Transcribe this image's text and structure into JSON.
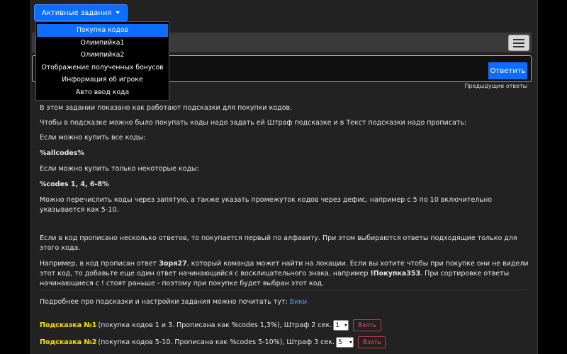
{
  "header": {
    "tasks_button_label": "Активные задания",
    "menu_items": [
      {
        "label": "Покупка кодов",
        "active": true
      },
      {
        "label": "Олимпийка1"
      },
      {
        "label": "Олимпийка2"
      },
      {
        "label": "Отображение полученных бонусов"
      },
      {
        "label": "Информация об игроке"
      },
      {
        "label": "Авто ввод кода"
      }
    ]
  },
  "answer": {
    "value": "",
    "submit_label": "Ответить",
    "previous_answers_link": "Предыдущие ответы"
  },
  "content": {
    "p1": "В этом задании показано как работают подсказки для покупки кодов.",
    "p2": "Чтобы в подсказке можно было покупать коды надо задать ей Штраф подсказке и в Текст подсказки надо прописать:",
    "p3": "Если можно купить все коды:",
    "code_all": "%allcodes%",
    "p4": "Если можно купить только некоторые коды:",
    "code_some": "%codes 1, 4, 6-8%",
    "p5": "Можно перечислить коды через запятую, а также указать промежуток кодов через дефис, например с 5 по 10 включительно указывается как 5-10.",
    "p6": "Если в код прописано несколько ответов, то покупается первый по алфавиту. При этом выбираются ответы подходящие только для этого кода.",
    "p7_a": "Например, в код прописан ответ ",
    "p7_b": "Зоря27",
    "p7_c": ", который команда может найти на локации. Если вы хотите чтобы при покупке они не видели этот код, то добавьте еще один ответ начинающийся с восклицательного знака, например ",
    "p7_d": "!Покупка353",
    "p7_e": ". При сортировке ответы начинающиеся с ! стоят раньше - поэтому при покупке будет выбран этот код.",
    "p8": "Подробнее про подсказки и настройки задания можно почитать тут: ",
    "wiki_link": "Вики"
  },
  "hints": [
    {
      "title": "Подсказка №1",
      "desc": "(покупка кодов 1 и 3. Прописана как %codes 1,3%), Штраф 2 сек.",
      "selected": "1",
      "take_label": "Взять"
    },
    {
      "title": "Подсказка №2",
      "desc": "(покупка кодов 5-10. Прописана как %codes 5-10%), Штраф 3 сек.",
      "selected": "5",
      "take_label": "Взять"
    }
  ]
}
